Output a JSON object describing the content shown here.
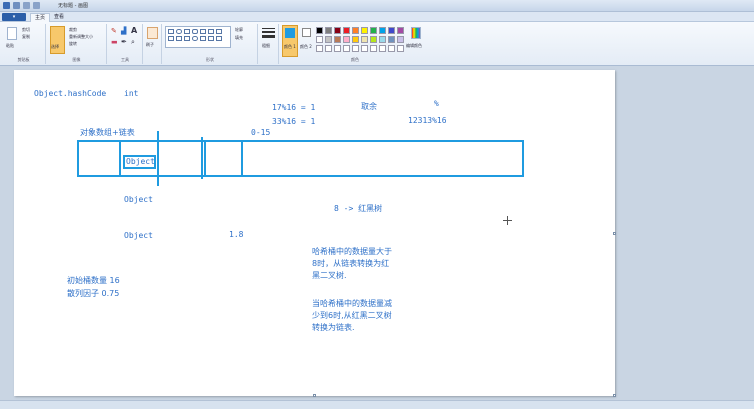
{
  "window": {
    "title": "无标题 - 画图"
  },
  "tabs": {
    "file": "",
    "home": "主页",
    "view": "查看"
  },
  "ribbon": {
    "clipboard": {
      "label": "剪贴板",
      "paste": "粘贴",
      "cut": "剪切",
      "copy": "复制"
    },
    "image": {
      "label": "图像",
      "select": "选择",
      "crop": "裁剪",
      "resize": "重新调整大小",
      "rotate": "旋转"
    },
    "tools": {
      "label": "工具"
    },
    "brushes": {
      "label": "刷子"
    },
    "shapes": {
      "label": "形状",
      "outline": "轮廓",
      "fill": "填充"
    },
    "size": {
      "label": "粗细"
    },
    "colors": {
      "label": "颜色",
      "color1": "颜色 1",
      "color2": "颜色 2",
      "edit": "编辑颜色",
      "palette": [
        "#000000",
        "#7f7f7f",
        "#880015",
        "#ed1c24",
        "#ff7f27",
        "#fff200",
        "#22b14c",
        "#00a2e8",
        "#3f48cc",
        "#a349a4",
        "#ffffff",
        "#c3c3c3",
        "#b97a57",
        "#ffaec9",
        "#ffc90e",
        "#efe4b0",
        "#b5e61d",
        "#99d9ea",
        "#7092be",
        "#c8bfe7"
      ],
      "accent": "#1f9be0"
    }
  },
  "canvas": {
    "hashcode": "Object.hashCode",
    "int": "int",
    "mod1": "17%16 = 1",
    "mod2": "33%16 = 1",
    "quyu": "取余",
    "percent": "%",
    "example": "12313%16",
    "array_label": "对象数组+链表",
    "range": "0-15",
    "obj1": "Object",
    "obj2": "Object",
    "obj3": "Object",
    "tree": "8 -> 红黑树",
    "factor_val": "1.8",
    "note1": [
      "哈希桶中的数据量大于",
      "8时，从链表转换为红",
      "黑二叉树."
    ],
    "note2": [
      "当哈希桶中的数据量减",
      "少到6时,从红黑二叉树",
      "转换为链表."
    ],
    "init_cap": "初始桶数量 16",
    "load_factor": "散列因子 0.75"
  }
}
